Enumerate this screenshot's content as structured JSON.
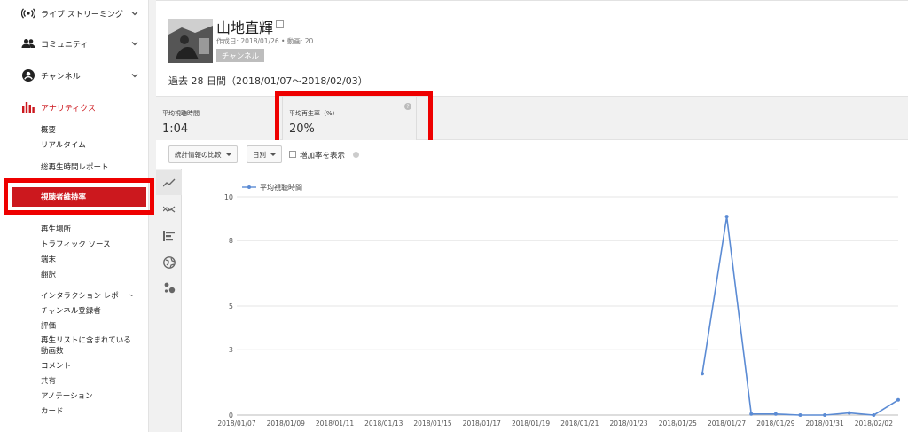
{
  "sidebar": {
    "main_items": [
      {
        "label": "ライブ ストリーミング",
        "icon": "broadcast-icon"
      },
      {
        "label": "コミュニティ",
        "icon": "people-icon"
      },
      {
        "label": "チャンネル",
        "icon": "account-circle-icon"
      },
      {
        "label": "アナリティクス",
        "icon": "bar-chart-icon"
      }
    ],
    "sub_items": [
      "概要",
      "リアルタイム",
      "総再生時間レポート",
      "視聴者維持率",
      "再生場所",
      "トラフィック ソース",
      "端末",
      "翻訳",
      "インタラクション レポート",
      "チャンネル登録者",
      "評価",
      "再生リストに含まれている",
      "動画数",
      "コメント",
      "共有",
      "アノテーション",
      "カード"
    ],
    "accent": "#cc181e"
  },
  "channel": {
    "name": "山地直輝",
    "meta": "作成日: 2018/01/26 • 動画: 20",
    "badge": "チャンネル"
  },
  "period": "過去 28 日間（2018/01/07〜2018/02/03）",
  "metrics": [
    {
      "title": "平均視聴時間",
      "value": "1:04"
    },
    {
      "title": "平均再生率（%）",
      "value": "20%"
    }
  ],
  "toolbar": {
    "compare_label": "統計情報の比較",
    "granularity_label": "日別",
    "growth_label": "増加率を表示"
  },
  "chart_data": {
    "type": "line",
    "series": [
      {
        "name": "平均視聴時間",
        "color": "#5b8bd4",
        "x": [
          "2018/01/26",
          "2018/01/27",
          "2018/01/28",
          "2018/01/29",
          "2018/01/30",
          "2018/01/31",
          "2018/02/01",
          "2018/02/02",
          "2018/02/03"
        ],
        "values": [
          1.9,
          9.1,
          0.05,
          0.05,
          0,
          0,
          0.1,
          0,
          0.7
        ]
      }
    ],
    "x_ticks": [
      "2018/01/07",
      "2018/01/09",
      "2018/01/11",
      "2018/01/13",
      "2018/01/15",
      "2018/01/17",
      "2018/01/19",
      "2018/01/21",
      "2018/01/23",
      "2018/01/25",
      "2018/01/27",
      "2018/01/29",
      "2018/01/31",
      "2018/02/02"
    ],
    "y_ticks": [
      "10",
      "8",
      "5",
      "3",
      "0"
    ],
    "ylim": [
      0,
      10
    ],
    "x_start": "2018/01/07",
    "x_end": "2018/02/03",
    "grid": true,
    "legend": "top-left"
  }
}
